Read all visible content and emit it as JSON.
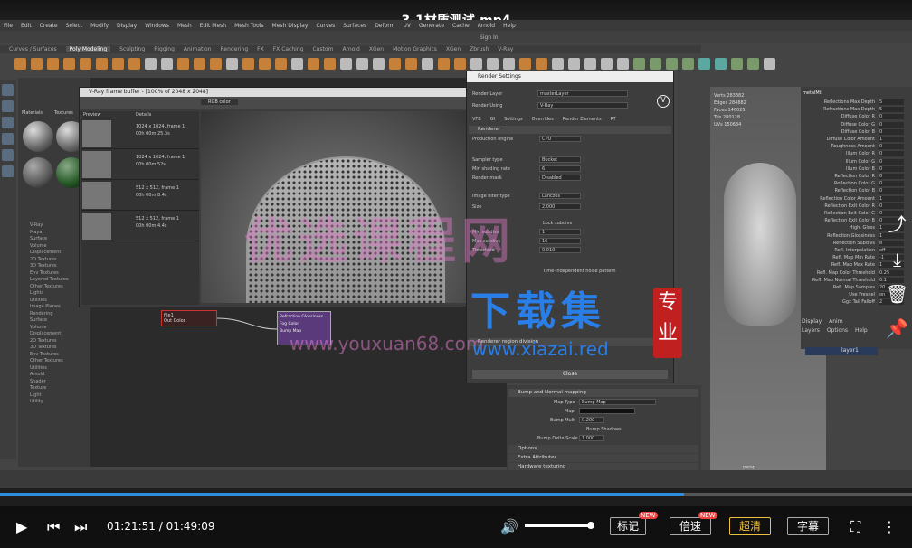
{
  "video": {
    "title": "3-1材质测试.mp4",
    "current_time": "01:21:51",
    "separator": "/",
    "duration": "01:49:09",
    "progress_fraction": 0.75,
    "volume_fraction": 0.97,
    "buttons": {
      "annotate": "标记",
      "speed": "倍速",
      "quality": "超清",
      "subtitle": "字幕"
    },
    "new_badge": "NEW"
  },
  "maya": {
    "menu": [
      "File",
      "Edit",
      "Create",
      "Select",
      "Modify",
      "Display",
      "Windows",
      "Mesh",
      "Edit Mesh",
      "Mesh Tools",
      "Mesh Display",
      "Curves",
      "Surfaces",
      "Deform",
      "UV",
      "Generate",
      "Cache",
      "Arnold",
      "Help"
    ],
    "shelf_tabs": [
      "Curves / Surfaces",
      "Poly Modeling",
      "Sculpting",
      "Rigging",
      "Animation",
      "Rendering",
      "FX",
      "FX Caching",
      "Custom",
      "Arnold",
      "XGen",
      "Motion Graphics",
      "XGen",
      "Zbrush",
      "V-Ray"
    ],
    "signin": "Sign In",
    "hypershade_tabs": [
      "Materials",
      "Textures"
    ],
    "node_list": [
      "V-Ray",
      "Maya",
      "Surface",
      "Volume",
      "Displacement",
      "2D Textures",
      "3D Textures",
      "Env Textures",
      "Layered Textures",
      "Other Textures",
      "Lights",
      "Utilities",
      "Image Planes",
      "Rendering",
      "Surface",
      "Volume",
      "Displacement",
      "2D Textures",
      "3D Textures",
      "Env Textures",
      "Other Textures",
      "Utilities",
      "Arnold",
      "Shader",
      "Texture",
      "Light",
      "Utility"
    ],
    "vfb": {
      "title": "V-Ray frame buffer - [100% of 2048 x 2048]",
      "history_headers": [
        "Preview",
        "Details"
      ],
      "history": [
        {
          "details": "1024 x 1024, frame 1",
          "time": "00h 00m 25.3s"
        },
        {
          "details": "1024 x 1024, frame 1",
          "time": "00h 00m 52s"
        },
        {
          "details": "512 x 512, frame 1",
          "time": "00h 00m 8.4s"
        },
        {
          "details": "512 x 512, frame 1",
          "time": "00h 00m 4.4s"
        }
      ],
      "rgb_label": "RGB color"
    },
    "render_settings": {
      "title": "Render Settings",
      "render_layer_label": "Render Layer",
      "render_layer_value": "masterLayer",
      "render_using_label": "Render Using",
      "render_using_value": "V-Ray",
      "tabs": [
        "VFB",
        "GI",
        "Settings",
        "Overrides",
        "Render Elements",
        "RT"
      ],
      "section_renderer": "Renderer",
      "fields": [
        {
          "label": "Production engine",
          "value": "CPU"
        },
        {
          "label": "Sampler type",
          "value": "Bucket"
        },
        {
          "label": "Min shading rate",
          "value": "6"
        },
        {
          "label": "Render mask",
          "value": "Disabled"
        },
        {
          "label": "Image filter type",
          "value": "Lanczos"
        },
        {
          "label": "Size",
          "value": "2.000"
        },
        {
          "label": "Min subdivs",
          "value": "1"
        },
        {
          "label": "Max subdivs",
          "value": "16"
        },
        {
          "label": "Threshold",
          "value": "0.010"
        }
      ],
      "lock_subdivs": "Lock subdivs",
      "time_seed": "Time-independent noise pattern",
      "rollout": "Renderer region division",
      "close": "Close"
    },
    "attr_editor": {
      "section": "Bump and Normal mapping",
      "map_type_label": "Map Type",
      "map_type_value": "Bump Map",
      "map_label": "Map",
      "bump_mult_label": "Bump Mult",
      "bump_mult_value": "0.200",
      "bump_shadows": "Bump Shadows",
      "bump_delta_label": "Bump Delta Scale",
      "bump_delta_value": "1.000",
      "collapsed": [
        "Options",
        "Extra Attributes",
        "Hardware texturing"
      ]
    },
    "viewport_stats": [
      {
        "label": "Verts",
        "value": "283882"
      },
      {
        "label": "Edges",
        "value": "284882"
      },
      {
        "label": "Faces",
        "value": "140025"
      },
      {
        "label": "Tris",
        "value": "280128"
      },
      {
        "label": "UVs",
        "value": "150634"
      }
    ],
    "viewport_menu": [
      "View",
      "Shading",
      "Lighting",
      "Show"
    ],
    "camera_label": "persp",
    "channel_tabs": [
      "Channels",
      "Edit",
      "Object",
      "Show"
    ],
    "channel_object": "metalMtl",
    "channels": [
      {
        "label": "Reflections Max Depth",
        "value": "5"
      },
      {
        "label": "Refractions Max Depth",
        "value": "5"
      },
      {
        "label": "Diffuse Color R",
        "value": "0"
      },
      {
        "label": "Diffuse Color G",
        "value": "0"
      },
      {
        "label": "Diffuse Color B",
        "value": "0"
      },
      {
        "label": "Diffuse Color Amount",
        "value": "1"
      },
      {
        "label": "Roughness Amount",
        "value": "0"
      },
      {
        "label": "Illum Color R",
        "value": "0"
      },
      {
        "label": "Illum Color G",
        "value": "0"
      },
      {
        "label": "Illum Color B",
        "value": "0"
      },
      {
        "label": "Reflection Color R",
        "value": "0"
      },
      {
        "label": "Reflection Color G",
        "value": "0"
      },
      {
        "label": "Reflection Color B",
        "value": "0"
      },
      {
        "label": "Reflection Color Amount",
        "value": "1"
      },
      {
        "label": "Reflection Exit Color R",
        "value": "0"
      },
      {
        "label": "Reflection Exit Color G",
        "value": "0"
      },
      {
        "label": "Reflection Exit Color B",
        "value": "0"
      },
      {
        "label": "High. Gloss",
        "value": "1"
      },
      {
        "label": "Reflection Glossiness",
        "value": "1"
      },
      {
        "label": "Reflection Subdivs",
        "value": "8"
      },
      {
        "label": "Refl. Interpolation",
        "value": "off"
      },
      {
        "label": "Refl. Map Min Rate",
        "value": "-1"
      },
      {
        "label": "Refl. Map Max Rate",
        "value": "1"
      },
      {
        "label": "Refl. Map Color Threshold",
        "value": "0.25"
      },
      {
        "label": "Refl. Map Normal Threshold",
        "value": "0.1"
      },
      {
        "label": "Refl. Map Samples",
        "value": "20"
      },
      {
        "label": "Use Fresnel",
        "value": "on"
      },
      {
        "label": "Ggx Tail Falloff",
        "value": "2"
      }
    ],
    "layer_tabs": [
      "Display",
      "Anim"
    ],
    "layer_menu": [
      "Layers",
      "Options",
      "Help"
    ],
    "layer_name": "layer1",
    "hypershade_nodes": [
      "Out Color",
      "Refraction Glossiness",
      "Fog Color",
      "Bump Map"
    ],
    "file_node": "file1"
  },
  "watermarks": {
    "main": "优选课程网",
    "url": "www.youxuan68.com",
    "xiazai": "下载集",
    "xiazai_url": "www.xiazai.red",
    "zhuanye": "专业"
  },
  "colors": {
    "progress": "#2a8fe0",
    "accent_new": "#e44444"
  }
}
